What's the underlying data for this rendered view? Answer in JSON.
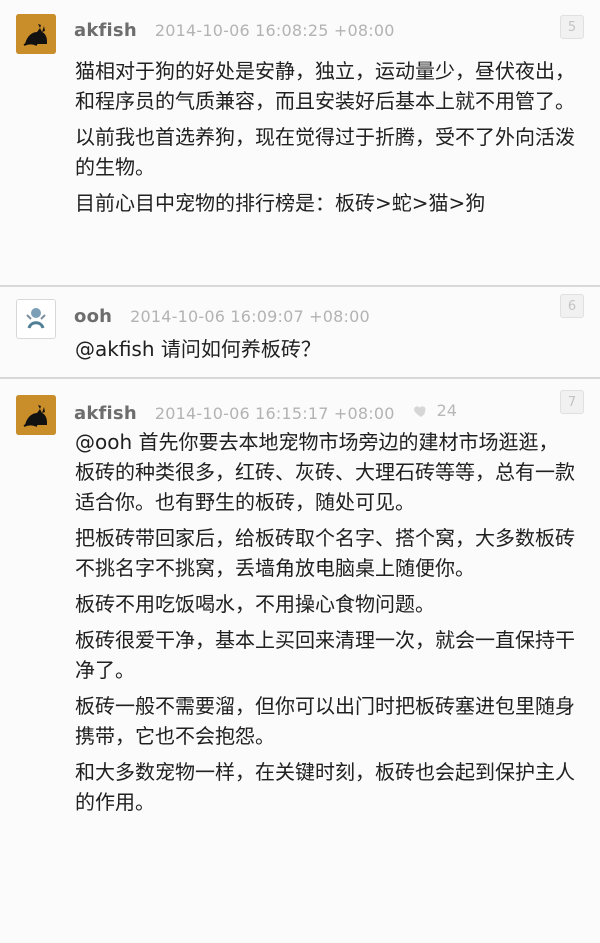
{
  "posts": [
    {
      "username": "akfish",
      "timestamp": "2014-10-06 16:08:25 +08:00",
      "floor": "5",
      "paragraphs": [
        "猫相对于狗的好处是安静，独立，运动量少，昼伏夜出，和程序员的气质兼容，而且安装好后基本上就不用管了。",
        "以前我也首选养狗，现在觉得过于折腾，受不了外向活泼的生物。",
        "目前心目中宠物的排行榜是：板砖>蛇>猫>狗"
      ],
      "avatar": "cat-avatar-icon"
    },
    {
      "username": "ooh",
      "timestamp": "2014-10-06 16:09:07 +08:00",
      "floor": "6",
      "paragraphs": [
        "@akfish 请问如何养板砖？"
      ],
      "avatar": "ooh-avatar-icon"
    },
    {
      "username": "akfish",
      "timestamp": "2014-10-06 16:15:17 +08:00",
      "likes": "24",
      "floor": "7",
      "paragraphs": [
        "@ooh 首先你要去本地宠物市场旁边的建材市场逛逛，板砖的种类很多，红砖、灰砖、大理石砖等等，总有一款适合你。也有野生的板砖，随处可见。",
        "把板砖带回家后，给板砖取个名字、搭个窝，大多数板砖不挑名字不挑窝，丢墙角放电脑桌上随便你。",
        "板砖不用吃饭喝水，不用操心食物问题。",
        "板砖很爱干净，基本上买回来清理一次，就会一直保持干净了。",
        "板砖一般不需要溜，但你可以出门时把板砖塞进包里随身携带，它也不会抱怨。",
        "和大多数宠物一样，在关键时刻，板砖也会起到保护主人的作用。"
      ],
      "avatar": "cat-avatar-icon"
    }
  ],
  "colors": {
    "background": "#f4f4f4",
    "username": "#6d6d6d",
    "timestamp": "#b3b3b3",
    "text": "#202020",
    "avatar_cat_bg": "#c98d2a"
  }
}
